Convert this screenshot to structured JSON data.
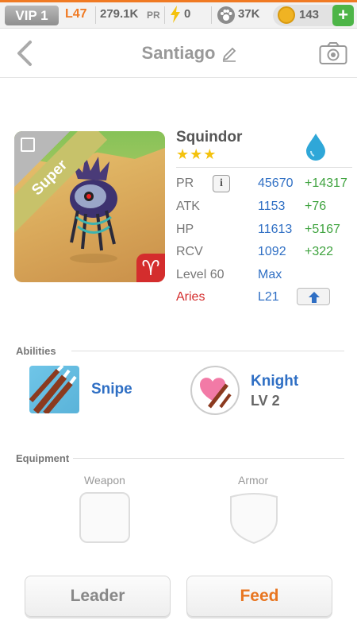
{
  "topbar": {
    "vip": "VIP 1",
    "level": "L47",
    "pr_value": "279.1K",
    "pr_unit": "PR",
    "energy": "0",
    "paws": "37K",
    "coins": "143",
    "plus": "+",
    "colors": {
      "accent": "#f07a23",
      "plus_button": "#4db547",
      "coin": "#f0b323"
    }
  },
  "header": {
    "title": "Santiago"
  },
  "monster": {
    "name": "Squindor",
    "stars": "★★★",
    "rarity_ribbon": "Super",
    "element": "water-drop-icon",
    "stats": [
      {
        "label": "PR",
        "value": "45670",
        "bonus": "+14317"
      },
      {
        "label": "ATK",
        "value": "1153",
        "bonus": "+76"
      },
      {
        "label": "HP",
        "value": "11613",
        "bonus": "+5167"
      },
      {
        "label": "RCV",
        "value": "1092",
        "bonus": "+322"
      }
    ],
    "level_label": "Level 60",
    "level_value": "Max",
    "sign_label": "Aries",
    "sign_value": "L21",
    "info_button": "i"
  },
  "abilities": {
    "section_label": "Abilities",
    "items": [
      {
        "name": "Snipe"
      },
      {
        "name": "Knight",
        "level": "LV 2"
      }
    ]
  },
  "equipment": {
    "section_label": "Equipment",
    "weapon_label": "Weapon",
    "armor_label": "Armor"
  },
  "buttons": {
    "leader": "Leader",
    "feed": "Feed"
  }
}
